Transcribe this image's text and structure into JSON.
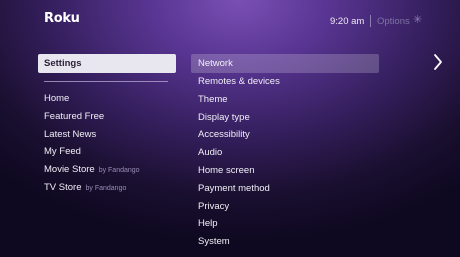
{
  "header": {
    "logo": "Roku",
    "time": "9:20 am",
    "options_label": "Options",
    "options_icon": "asterisk-icon"
  },
  "left_menu": {
    "selected": "Settings",
    "items": [
      {
        "label": "Home",
        "sub": ""
      },
      {
        "label": "Featured Free",
        "sub": ""
      },
      {
        "label": "Latest News",
        "sub": ""
      },
      {
        "label": "My Feed",
        "sub": ""
      },
      {
        "label": "Movie Store",
        "sub": "by Fandango"
      },
      {
        "label": "TV Store",
        "sub": "by Fandango"
      }
    ]
  },
  "settings_menu": {
    "items": [
      "Network",
      "Remotes & devices",
      "Theme",
      "Display type",
      "Accessibility",
      "Audio",
      "Home screen",
      "Payment method",
      "Privacy",
      "Help",
      "System"
    ]
  },
  "colors": {
    "background_top": "#7a4fb4",
    "background_bottom": "#0e0820",
    "selected_bg": "#e8e6ee",
    "selected_text": "#2a1f3a"
  }
}
